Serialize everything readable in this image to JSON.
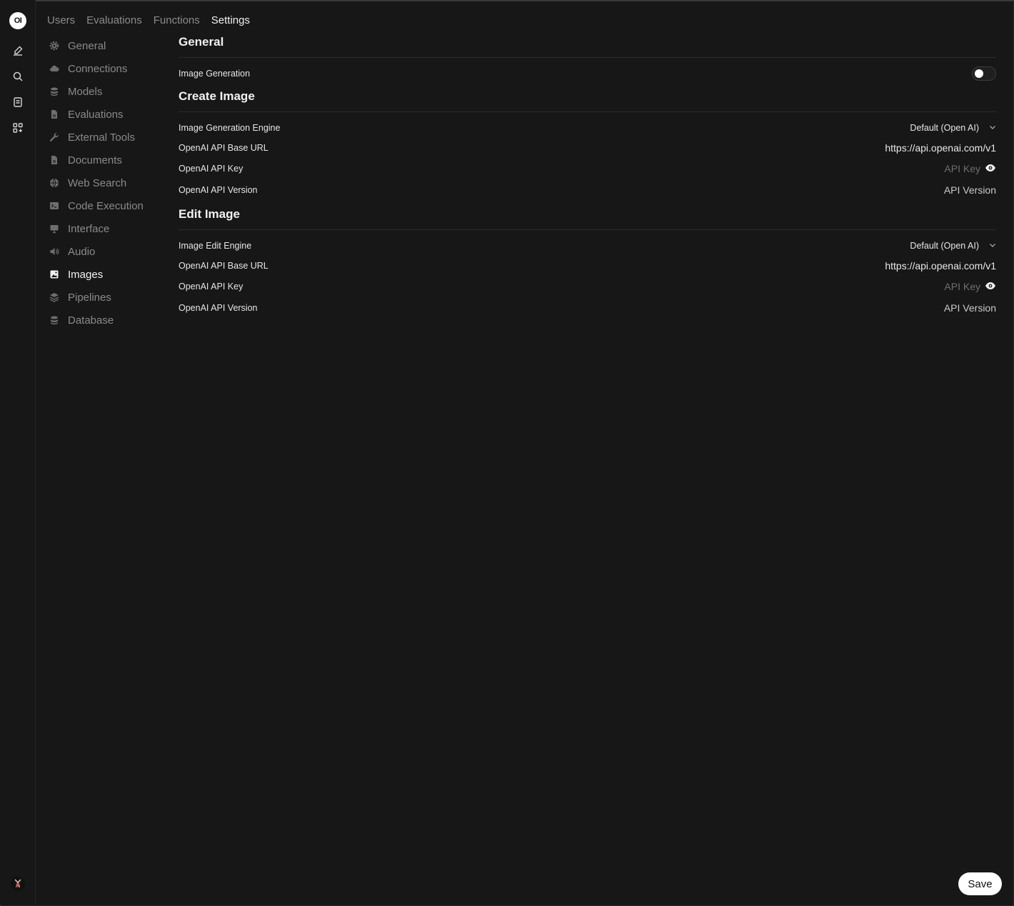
{
  "rail": {
    "logo_text": "OI",
    "icons": [
      "new-chat-icon",
      "search-icon",
      "notes-icon",
      "workspace-icon"
    ]
  },
  "top_tabs": [
    {
      "label": "Users",
      "active": false
    },
    {
      "label": "Evaluations",
      "active": false
    },
    {
      "label": "Functions",
      "active": false
    },
    {
      "label": "Settings",
      "active": true
    }
  ],
  "settings_nav": [
    {
      "label": "General",
      "icon": "gear-icon"
    },
    {
      "label": "Connections",
      "icon": "cloud-icon"
    },
    {
      "label": "Models",
      "icon": "stack-icon"
    },
    {
      "label": "Evaluations",
      "icon": "document-icon"
    },
    {
      "label": "External Tools",
      "icon": "wrench-icon"
    },
    {
      "label": "Documents",
      "icon": "document-icon"
    },
    {
      "label": "Web Search",
      "icon": "globe-icon"
    },
    {
      "label": "Code Execution",
      "icon": "terminal-icon"
    },
    {
      "label": "Interface",
      "icon": "monitor-icon"
    },
    {
      "label": "Audio",
      "icon": "speaker-icon"
    },
    {
      "label": "Images",
      "icon": "image-icon",
      "active": true
    },
    {
      "label": "Pipelines",
      "icon": "layers-icon"
    },
    {
      "label": "Database",
      "icon": "database-icon"
    }
  ],
  "general": {
    "title": "General",
    "image_generation_label": "Image Generation",
    "image_generation_enabled": false
  },
  "create_image": {
    "title": "Create Image",
    "engine_label": "Image Generation Engine",
    "engine_value": "Default (Open AI)",
    "base_url_label": "OpenAI API Base URL",
    "base_url_value": "https://api.openai.com/v1",
    "api_key_label": "OpenAI API Key",
    "api_key_placeholder": "API Key",
    "api_version_label": "OpenAI API Version",
    "api_version_placeholder": "API Version"
  },
  "edit_image": {
    "title": "Edit Image",
    "engine_label": "Image Edit Engine",
    "engine_value": "Default (Open AI)",
    "base_url_label": "OpenAI API Base URL",
    "base_url_value": "https://api.openai.com/v1",
    "api_key_label": "OpenAI API Key",
    "api_key_placeholder": "API Key",
    "api_version_label": "OpenAI API Version",
    "api_version_placeholder": "API Version"
  },
  "save_label": "Save",
  "colors": {
    "background": "#171717",
    "text": "#ececec",
    "muted": "#8a8a8a",
    "save_bg": "#ffffff"
  }
}
